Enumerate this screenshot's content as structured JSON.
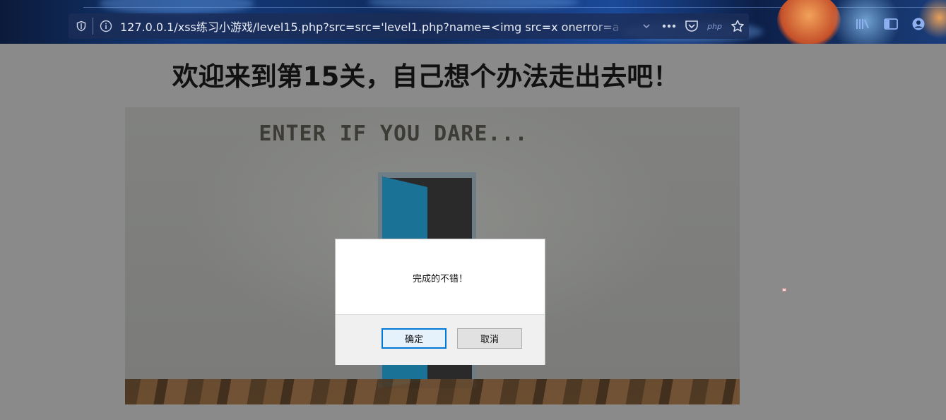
{
  "browser": {
    "url": "127.0.0.1/xss练习小游戏/level15.php?src=src='level1.php?name=<img src=x onerror=a",
    "php_badge": "php",
    "icons": {
      "tracking": "shield-icon",
      "site_info": "info-icon",
      "dropdown": "chevron-down-icon",
      "page_actions": "more-icon",
      "pocket": "pocket-icon",
      "bookmark": "star-icon",
      "library": "library-icon",
      "sidebar": "sidebar-icon",
      "account": "account-icon"
    }
  },
  "page": {
    "heading": "欢迎来到第15关，自己想个办法走出去吧！",
    "scene_caption": "ENTER IF YOU DARE..."
  },
  "dialog": {
    "message": "完成的不错！",
    "ok_label": "确定",
    "cancel_label": "取消"
  },
  "colors": {
    "overlay": "#8a8a8a",
    "accent": "#0078d7",
    "door": "#1a7296"
  }
}
